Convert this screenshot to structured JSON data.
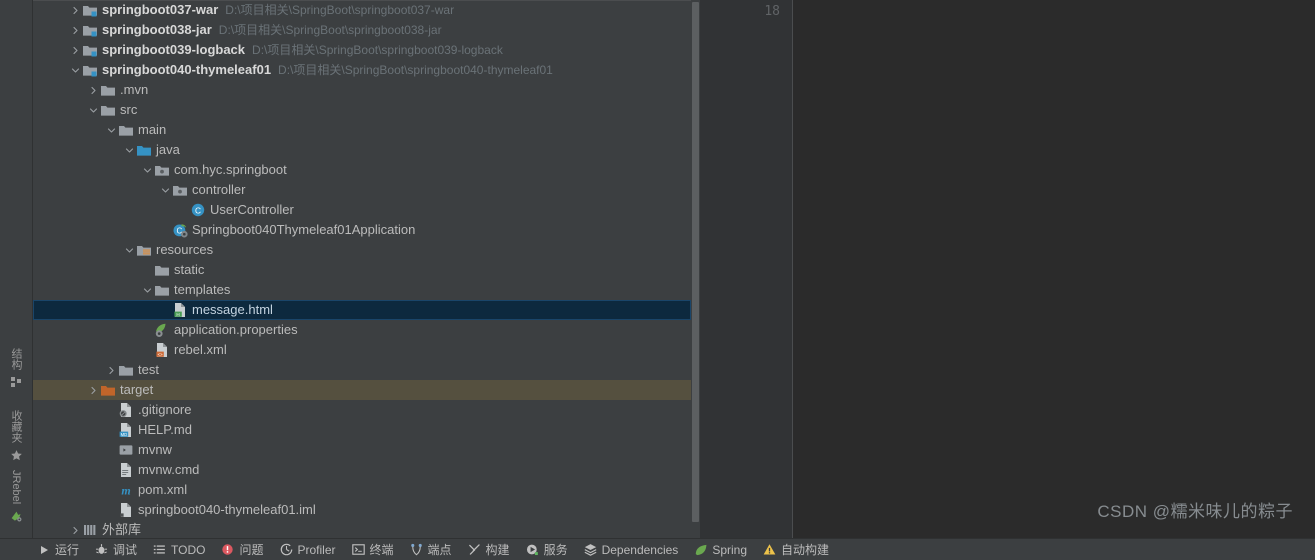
{
  "left_rail": {
    "groups": [
      {
        "label": "结构",
        "icon": "structure-icon"
      },
      {
        "label": "收藏夹",
        "icon": "star-icon"
      },
      {
        "label": "JRebel",
        "icon": "jrebel-icon"
      }
    ]
  },
  "tree": {
    "rows": [
      {
        "indent": 0,
        "arrow": "right",
        "icon": "module-icon",
        "label": "springboot037-war",
        "bold": true,
        "path": "D:\\项目相关\\SpringBoot\\springboot037-war",
        "state": "normal"
      },
      {
        "indent": 0,
        "arrow": "right",
        "icon": "module-icon",
        "label": "springboot038-jar",
        "bold": true,
        "path": "D:\\项目相关\\SpringBoot\\springboot038-jar",
        "state": "normal"
      },
      {
        "indent": 0,
        "arrow": "right",
        "icon": "module-icon",
        "label": "springboot039-logback",
        "bold": true,
        "path": "D:\\项目相关\\SpringBoot\\springboot039-logback",
        "state": "normal"
      },
      {
        "indent": 0,
        "arrow": "down",
        "icon": "module-icon",
        "label": "springboot040-thymeleaf01",
        "bold": true,
        "path": "D:\\项目相关\\SpringBoot\\springboot040-thymeleaf01",
        "state": "normal"
      },
      {
        "indent": 1,
        "arrow": "right",
        "icon": "folder-gray-icon",
        "label": ".mvn",
        "bold": false,
        "path": "",
        "state": "normal"
      },
      {
        "indent": 1,
        "arrow": "down",
        "icon": "folder-gray-icon",
        "label": "src",
        "bold": false,
        "path": "",
        "state": "normal"
      },
      {
        "indent": 2,
        "arrow": "down",
        "icon": "folder-gray-icon",
        "label": "main",
        "bold": false,
        "path": "",
        "state": "normal"
      },
      {
        "indent": 3,
        "arrow": "down",
        "icon": "folder-source-icon",
        "label": "java",
        "bold": false,
        "path": "",
        "state": "normal"
      },
      {
        "indent": 4,
        "arrow": "down",
        "icon": "package-icon",
        "label": "com.hyc.springboot",
        "bold": false,
        "path": "",
        "state": "normal"
      },
      {
        "indent": 5,
        "arrow": "down",
        "icon": "package-icon",
        "label": "controller",
        "bold": false,
        "path": "",
        "state": "normal"
      },
      {
        "indent": 6,
        "arrow": "none",
        "icon": "java-class-icon",
        "label": "UserController",
        "bold": false,
        "path": "",
        "state": "normal"
      },
      {
        "indent": 5,
        "arrow": "none",
        "icon": "spring-boot-class-icon",
        "label": "Springboot040Thymeleaf01Application",
        "bold": false,
        "path": "",
        "state": "normal"
      },
      {
        "indent": 3,
        "arrow": "down",
        "icon": "folder-resources-icon",
        "label": "resources",
        "bold": false,
        "path": "",
        "state": "normal"
      },
      {
        "indent": 4,
        "arrow": "none",
        "icon": "folder-gray-icon",
        "label": "static",
        "bold": false,
        "path": "",
        "state": "normal"
      },
      {
        "indent": 4,
        "arrow": "down",
        "icon": "folder-gray-icon",
        "label": "templates",
        "bold": false,
        "path": "",
        "state": "normal"
      },
      {
        "indent": 5,
        "arrow": "none",
        "icon": "html-file-icon",
        "label": "message.html",
        "bold": false,
        "path": "",
        "state": "selected"
      },
      {
        "indent": 4,
        "arrow": "none",
        "icon": "properties-file-icon",
        "label": "application.properties",
        "bold": false,
        "path": "",
        "state": "normal"
      },
      {
        "indent": 4,
        "arrow": "none",
        "icon": "xml-file-icon",
        "label": "rebel.xml",
        "bold": false,
        "path": "",
        "state": "normal"
      },
      {
        "indent": 2,
        "arrow": "right",
        "icon": "folder-gray-icon",
        "label": "test",
        "bold": false,
        "path": "",
        "state": "normal"
      },
      {
        "indent": 1,
        "arrow": "right",
        "icon": "folder-orange-icon",
        "label": "target",
        "bold": false,
        "path": "",
        "state": "target"
      },
      {
        "indent": 2,
        "arrow": "none",
        "icon": "gitignore-file-icon",
        "label": ".gitignore",
        "bold": false,
        "path": "",
        "state": "normal"
      },
      {
        "indent": 2,
        "arrow": "none",
        "icon": "markdown-file-icon",
        "label": "HELP.md",
        "bold": false,
        "path": "",
        "state": "normal"
      },
      {
        "indent": 2,
        "arrow": "none",
        "icon": "shell-file-icon",
        "label": "mvnw",
        "bold": false,
        "path": "",
        "state": "normal"
      },
      {
        "indent": 2,
        "arrow": "none",
        "icon": "cmd-file-icon",
        "label": "mvnw.cmd",
        "bold": false,
        "path": "",
        "state": "normal"
      },
      {
        "indent": 2,
        "arrow": "none",
        "icon": "maven-file-icon",
        "label": "pom.xml",
        "bold": false,
        "path": "",
        "state": "normal"
      },
      {
        "indent": 2,
        "arrow": "none",
        "icon": "iml-file-icon",
        "label": "springboot040-thymeleaf01.iml",
        "bold": false,
        "path": "",
        "state": "normal"
      },
      {
        "indent": 0,
        "arrow": "right",
        "icon": "external-libraries-icon",
        "label": "外部库",
        "bold": false,
        "path": "",
        "state": "normal"
      }
    ]
  },
  "editor": {
    "line_number": "18"
  },
  "watermark": {
    "text": "CSDN @糯米味儿的粽子"
  },
  "bottom_bar": {
    "items": [
      {
        "label": "运行",
        "icon": "run-icon"
      },
      {
        "label": "调试",
        "icon": "debug-icon"
      },
      {
        "label": "TODO",
        "icon": "todo-icon"
      },
      {
        "label": "问题",
        "icon": "problems-icon"
      },
      {
        "label": "Profiler",
        "icon": "profiler-icon"
      },
      {
        "label": "终端",
        "icon": "terminal-icon"
      },
      {
        "label": "端点",
        "icon": "endpoints-icon"
      },
      {
        "label": "构建",
        "icon": "build-icon"
      },
      {
        "label": "服务",
        "icon": "services-icon"
      },
      {
        "label": "Dependencies",
        "icon": "dependencies-icon"
      },
      {
        "label": "Spring",
        "icon": "spring-icon"
      },
      {
        "label": "自动构建",
        "icon": "warning-icon"
      }
    ]
  },
  "colors": {
    "panel_bg": "#3c3f41",
    "editor_bg": "#2b2b2b",
    "gutter_bg": "#313335",
    "selection_bg": "#0d293e",
    "target_bg": "#55503f",
    "text": "#bbbbbb",
    "path_text": "#6a7277"
  }
}
